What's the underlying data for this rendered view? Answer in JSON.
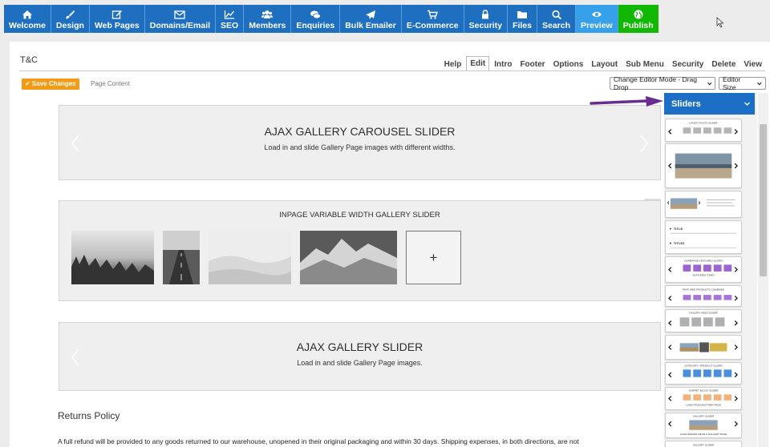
{
  "toolbar": {
    "items": [
      {
        "label": "Welcome",
        "icon": "home-icon"
      },
      {
        "label": "Design",
        "icon": "paintbrush-icon"
      },
      {
        "label": "Web Pages",
        "icon": "edit-icon"
      },
      {
        "label": "Domains/Email",
        "icon": "envelope-icon"
      },
      {
        "label": "SEO",
        "icon": "chart-line-icon"
      },
      {
        "label": "Members",
        "icon": "users-icon"
      },
      {
        "label": "Enquiries",
        "icon": "chat-icon"
      },
      {
        "label": "Bulk Emailer",
        "icon": "paper-plane-icon"
      },
      {
        "label": "E-Commerce",
        "icon": "cart-icon"
      },
      {
        "label": "Security",
        "icon": "lock-icon"
      },
      {
        "label": "Files",
        "icon": "folder-icon"
      },
      {
        "label": "Search",
        "icon": "search-icon"
      },
      {
        "label": "Preview",
        "icon": "eye-icon"
      },
      {
        "label": "Publish",
        "icon": "globe-icon"
      }
    ],
    "colors": {
      "default": "#1e6fc0",
      "preview": "#37a0ea",
      "publish": "#11b800"
    }
  },
  "page": {
    "title": "T&C"
  },
  "tabs": [
    "Help",
    "Edit",
    "Intro",
    "Footer",
    "Options",
    "Layout",
    "Sub Menu",
    "Security",
    "Delete",
    "View"
  ],
  "active_tab": "Edit",
  "save_button": "✔ Save Changes",
  "page_content_label": "Page Content",
  "editor_mode_select": "Change Editor Mode - Drag Drop",
  "editor_size_select": "Editor Size",
  "blocks": {
    "carousel": {
      "title": "AJAX GALLERY CAROUSEL SLIDER",
      "subtitle": "Load in and slide Gallery Page images with different widths."
    },
    "inpage": {
      "title": "INPAGE VARIABLE WIDTH GALLERY SLIDER",
      "add_label": "+"
    },
    "gallery": {
      "title": "AJAX GALLERY SLIDER",
      "subtitle": "Load in and slide Gallery Page images."
    }
  },
  "returns": {
    "heading": "Returns Policy",
    "text": "A full refund will be provided to any goods returned to our warehouse, unopened in their original packaging and within 30 days. Shipping expenses, in both directions, are not"
  },
  "sidebar": {
    "header": "Sliders",
    "cards": [
      {
        "label": "LATEST POSTS SLIDER",
        "kind": "squares-grey"
      },
      {
        "label": "",
        "kind": "image-large"
      },
      {
        "label": "",
        "kind": "image-text"
      },
      {
        "label": "TITLE",
        "label2": "TITLE2",
        "kind": "titles"
      },
      {
        "label": "HOMEPAGE FEATURED SLIDER",
        "label2": "FEATURED ITEMS",
        "kind": "squares-purple"
      },
      {
        "label": "FEATURED PRODUCTS COMBINED",
        "kind": "squares-purple-small"
      },
      {
        "label": "GALLERY FEED SLIDER",
        "kind": "squares-grey-wide"
      },
      {
        "label": "",
        "kind": "image-strip"
      },
      {
        "label": "CATEGORY / PRODUCT SLIDER",
        "kind": "squares-blue"
      },
      {
        "label": "SNIPPET BLOCK SLIDER",
        "label2": "LOAD FROM ANOTHER PAGE",
        "kind": "squares-orange"
      },
      {
        "label": "GALLERY SLIDER",
        "label2": "LOAD IMAGES FROM A GALLERY PAGE",
        "kind": "image-gallery"
      },
      {
        "label": "GALLERY SLIDER",
        "kind": "partial"
      }
    ]
  }
}
